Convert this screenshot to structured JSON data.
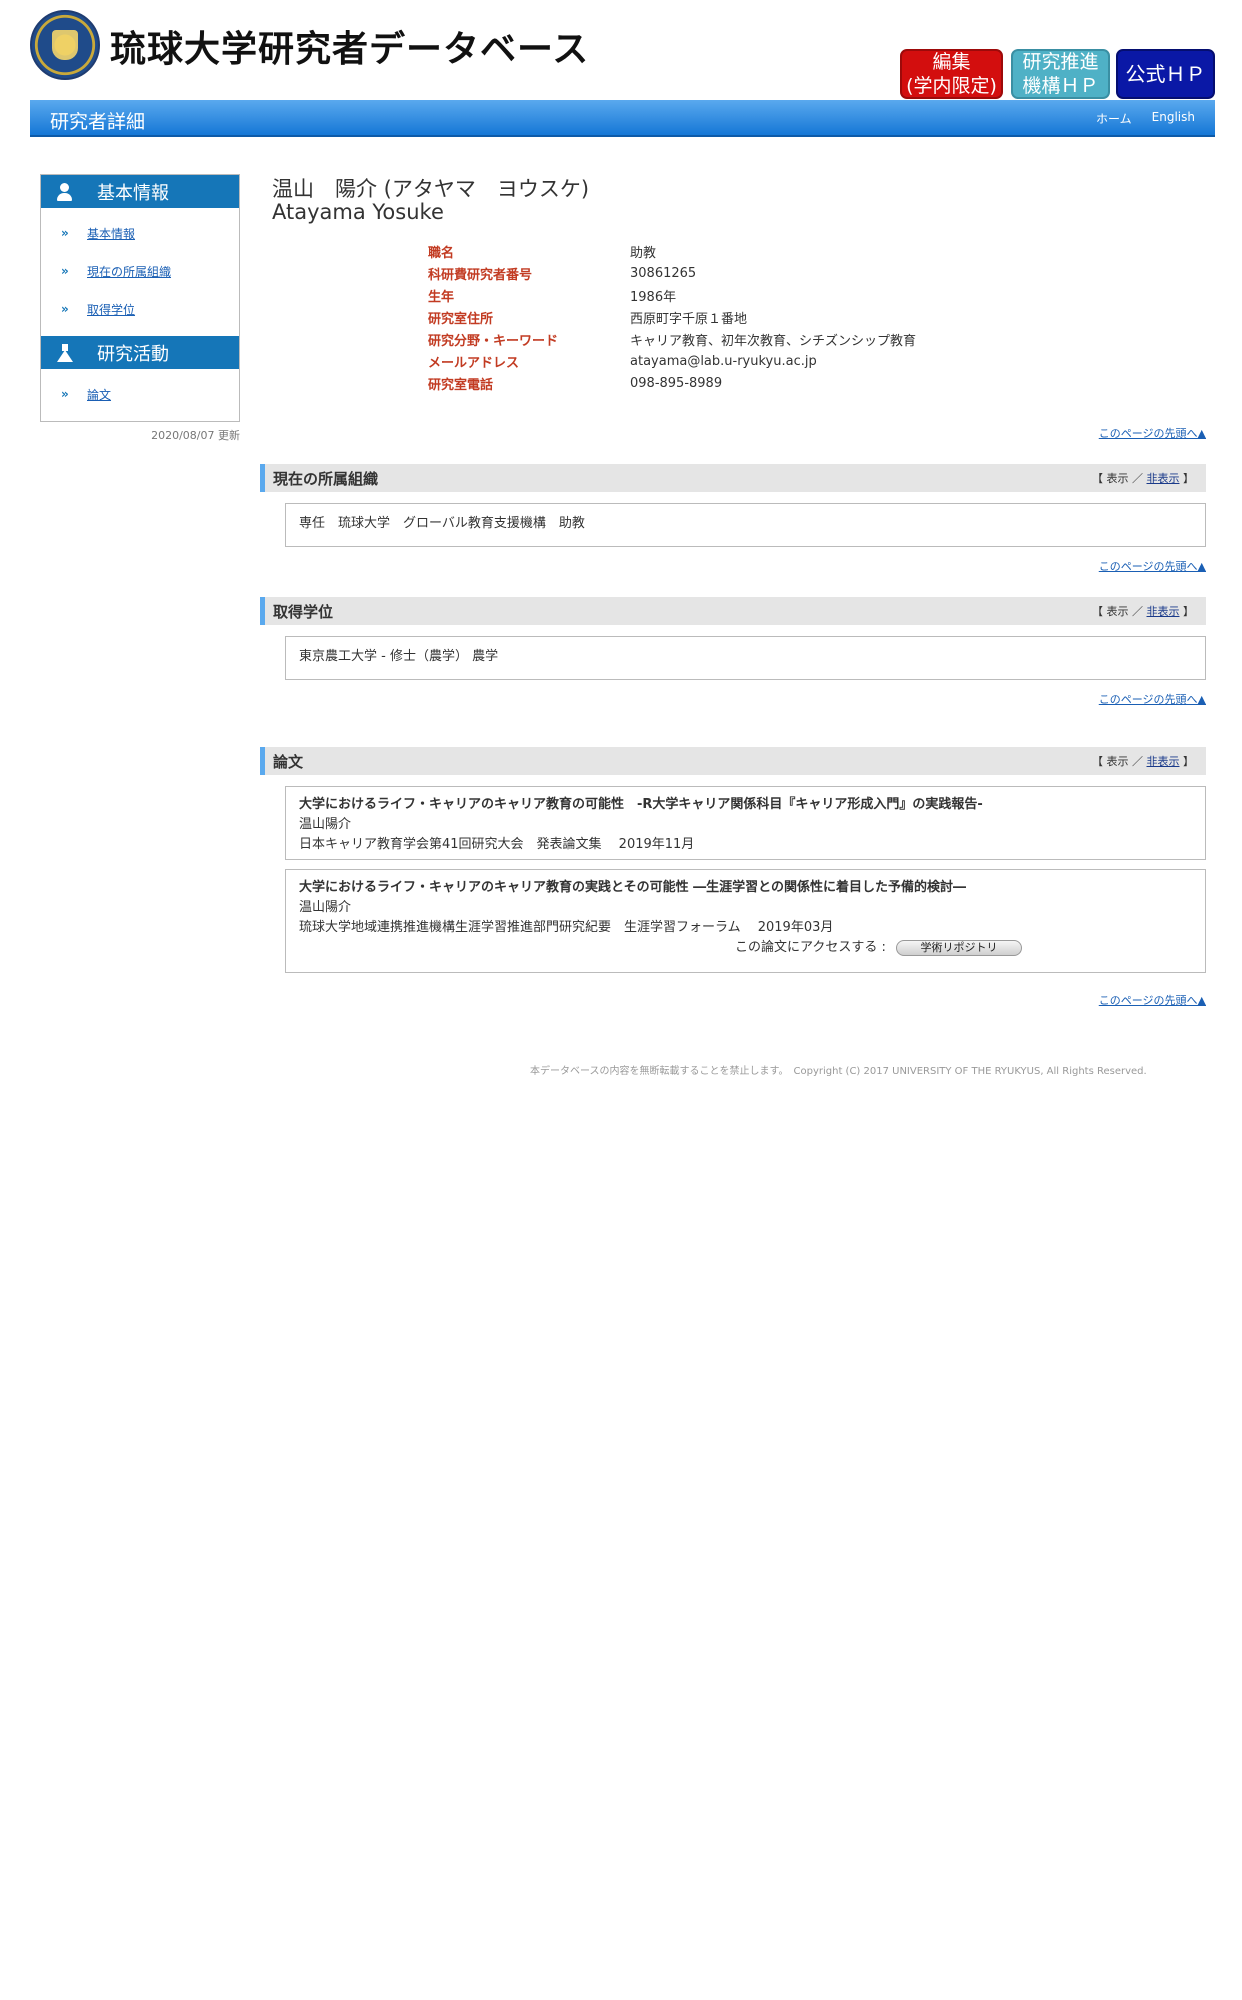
{
  "header": {
    "site_title": "琉球大学研究者データベース",
    "buttons": {
      "edit_line1": "編集",
      "edit_line2": "(学内限定)",
      "promo_line1": "研究推進",
      "promo_line2": "機構ＨＰ",
      "official": "公式ＨＰ"
    },
    "colors": {
      "edit": "#d30e0e",
      "promo": "#4fb1c6",
      "official": "#0a18a6"
    }
  },
  "bar": {
    "title": "研究者詳細",
    "home": "ホーム",
    "english": "English"
  },
  "sidebar": {
    "sections": [
      {
        "title": "基本情報",
        "icon": "user-icon",
        "items": [
          "基本情報",
          "現在の所属組織",
          "取得学位"
        ]
      },
      {
        "title": "研究活動",
        "icon": "flask-icon",
        "items": [
          "論文"
        ]
      }
    ],
    "updated": "2020/08/07 更新"
  },
  "profile": {
    "name_ja": "温山　陽介 (アタヤマ　ヨウスケ)",
    "name_en": "Atayama Yosuke",
    "fields": [
      {
        "label": "職名",
        "value": "助教"
      },
      {
        "label": "科研費研究者番号",
        "value": "30861265"
      },
      {
        "label": "生年",
        "value": "1986年"
      },
      {
        "label": "研究室住所",
        "value": "西原町字千原１番地"
      },
      {
        "label": "研究分野・キーワード",
        "value": "キャリア教育、初年次教育、シチズンシップ教育"
      },
      {
        "label": "メールアドレス",
        "value": "atayama@lab.u-ryukyu.ac.jp"
      },
      {
        "label": "研究室電話",
        "value": "098-895-8989"
      }
    ]
  },
  "to_top": "このページの先頭へ▲",
  "toggle": {
    "open": "【 表示 ／ ",
    "hide": "非表示",
    "close": " 】"
  },
  "sections": {
    "affiliation": {
      "title": "現在の所属組織",
      "content": "専任　琉球大学　グローバル教育支援機構　助教"
    },
    "degree": {
      "title": "取得学位",
      "content": "東京農工大学 -  修士（農学）  農学"
    },
    "papers": {
      "title": "論文",
      "items": [
        {
          "title": "大学におけるライフ・キャリアのキャリア教育の可能性　-R大学キャリア関係科目『キャリア形成入門』の実践報告-",
          "author": "温山陽介",
          "source": "日本キャリア教育学会第41回研究大会　発表論文集　 2019年11月"
        },
        {
          "title": "大学におけるライフ・キャリアのキャリア教育の実践とその可能性 ―生涯学習との関係性に着目した予備的検討―",
          "author": "温山陽介",
          "source": "琉球大学地域連携推進機構生涯学習推進部門研究紀要　生涯学習フォーラム　 2019年03月",
          "access_label": "この論文にアクセスする :",
          "repo_button": "学術リポジトリ"
        }
      ]
    }
  },
  "footer": "本データベースの内容を無断転載することを禁止します。　Copyright (C) 2017 UNIVERSITY OF THE RYUKYUS, All Rights Reserved."
}
